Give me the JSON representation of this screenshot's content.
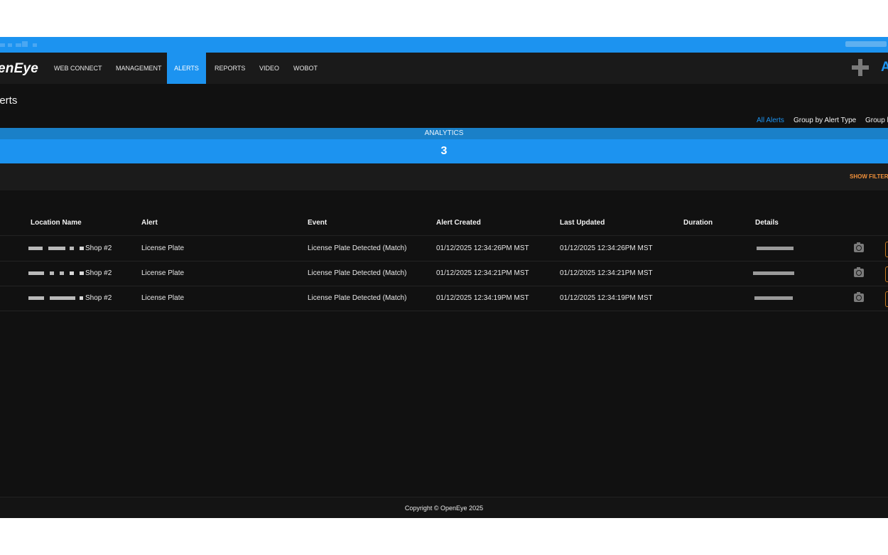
{
  "app": {
    "logo": "enEye"
  },
  "nav": {
    "items": [
      {
        "label": "WEB CONNECT",
        "active": false
      },
      {
        "label": "MANAGEMENT",
        "active": false
      },
      {
        "label": "ALERTS",
        "active": true
      },
      {
        "label": "REPORTS",
        "active": false
      },
      {
        "label": "VIDEO",
        "active": false
      },
      {
        "label": "WOBOT",
        "active": false
      }
    ],
    "add_icon": "plus-icon",
    "edge_glyph": "A"
  },
  "page": {
    "title": "lerts",
    "group_links": [
      {
        "label": "All Alerts",
        "active": true
      },
      {
        "label": "Group by Alert Type",
        "active": false
      },
      {
        "label": "Group b",
        "active": false
      }
    ]
  },
  "analytics": {
    "label": "ANALYTICS",
    "count": "3"
  },
  "filters": {
    "show_label": "SHOW FILTER"
  },
  "table": {
    "columns": [
      "Location Name",
      "Alert",
      "Event",
      "Alert Created",
      "Last Updated",
      "Duration",
      "Details"
    ],
    "rows": [
      {
        "location": "Shop #2",
        "alert": "License Plate",
        "event": "License Plate Detected (Match)",
        "created": "01/12/2025 12:34:26PM MST",
        "updated": "01/12/2025 12:34:26PM MST",
        "duration": ""
      },
      {
        "location": "Shop #2",
        "alert": "License Plate",
        "event": "License Plate Detected (Match)",
        "created": "01/12/2025 12:34:21PM MST",
        "updated": "01/12/2025 12:34:21PM MST",
        "duration": ""
      },
      {
        "location": "Shop #2",
        "alert": "License Plate",
        "event": "License Plate Detected (Match)",
        "created": "01/12/2025 12:34:19PM MST",
        "updated": "01/12/2025 12:34:19PM MST",
        "duration": ""
      }
    ]
  },
  "footer": {
    "copyright": "Copyright © OpenEye 2025"
  },
  "colors": {
    "accent": "#1c93f0",
    "background": "#111111",
    "filter_link": "#f0903a"
  }
}
